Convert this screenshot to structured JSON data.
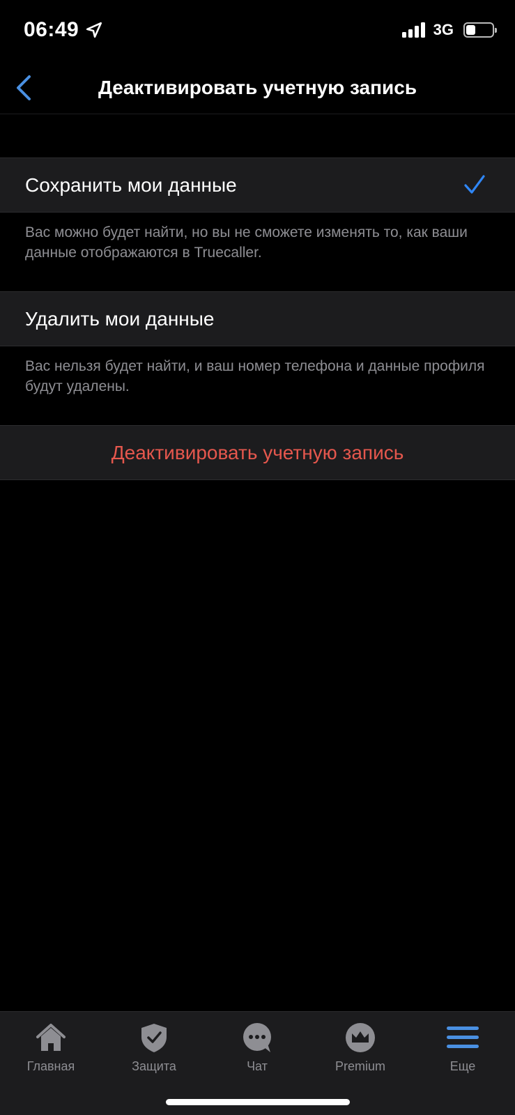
{
  "status": {
    "time": "06:49",
    "network": "3G",
    "battery_level": 0.35
  },
  "header": {
    "title": "Деактивировать учетную запись",
    "back_icon": "chevron-left-icon"
  },
  "options": [
    {
      "label": "Сохранить мои данные",
      "selected": true,
      "description": "Вас можно будет найти, но вы не сможете изменять то, как ваши данные отображаются в Truecaller."
    },
    {
      "label": "Удалить мои данные",
      "selected": false,
      "description": "Вас нельзя будет найти, и ваш номер телефона и данные профиля будут удалены."
    }
  ],
  "action": {
    "label": "Деактивировать учетную запись",
    "color": "#e5574d"
  },
  "tabbar": {
    "items": [
      {
        "label": "Главная",
        "icon": "home-icon",
        "active": false
      },
      {
        "label": "Защита",
        "icon": "shield-check-icon",
        "active": false
      },
      {
        "label": "Чат",
        "icon": "chat-icon",
        "active": false
      },
      {
        "label": "Premium",
        "icon": "crown-icon",
        "active": false
      },
      {
        "label": "Еще",
        "icon": "menu-icon",
        "active": true
      }
    ]
  },
  "colors": {
    "accent": "#4a90e2",
    "check": "#2f86f6",
    "row_bg": "#1c1c1e",
    "secondary_text": "#8e8e93"
  }
}
